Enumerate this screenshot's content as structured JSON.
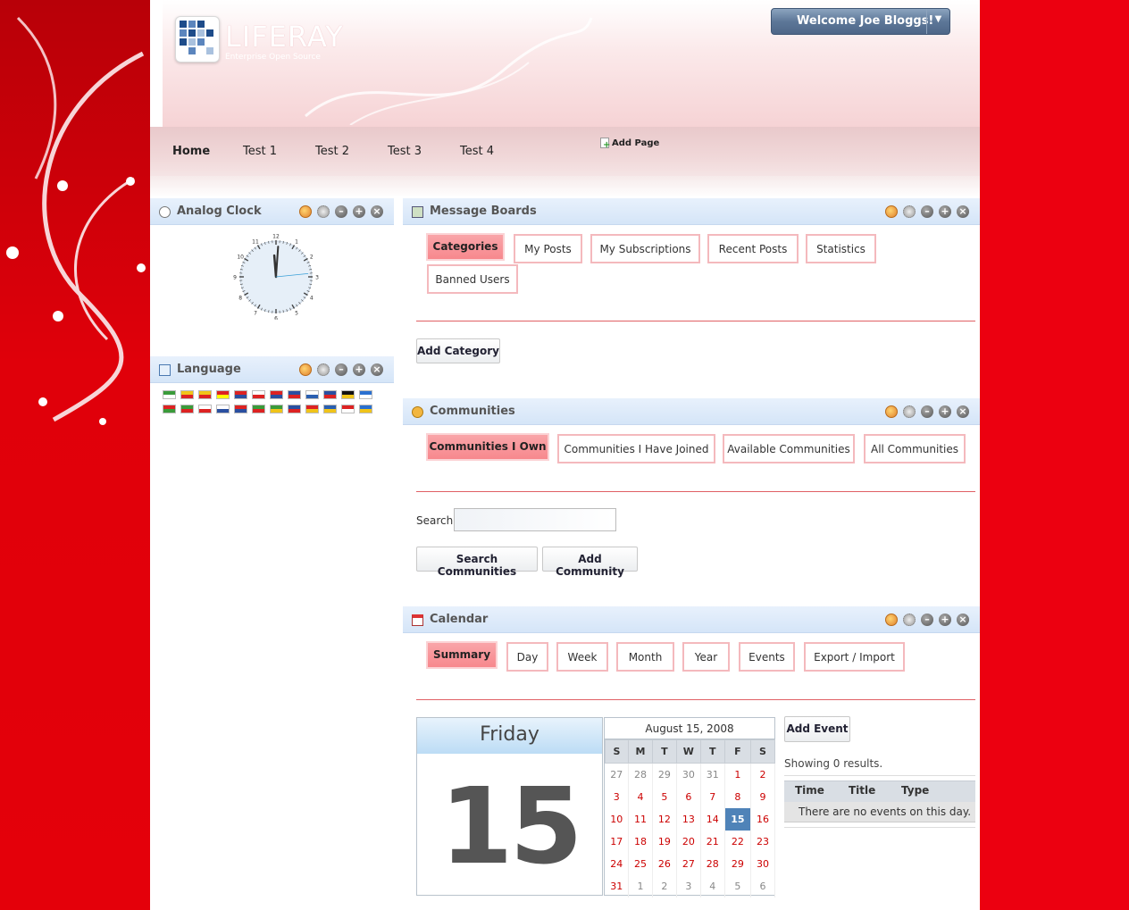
{
  "header": {
    "logo_text": "LIFERAY",
    "logo_tagline": "Enterprise Open Source",
    "welcome_label": "Welcome Joe Bloggs!"
  },
  "nav": {
    "items": [
      "Home",
      "Test 1",
      "Test 2",
      "Test 3",
      "Test 4"
    ],
    "add_page_label": "Add Page"
  },
  "clock_portlet": {
    "title": "Analog Clock",
    "numbers": [
      "12",
      "1",
      "2",
      "3",
      "4",
      "5",
      "6",
      "7",
      "8",
      "9",
      "10",
      "11"
    ]
  },
  "language_portlet": {
    "title": "Language"
  },
  "message_boards": {
    "title": "Message Boards",
    "tabs": [
      "Categories",
      "My Posts",
      "My Subscriptions",
      "Recent Posts",
      "Statistics",
      "Banned Users"
    ],
    "add_button": "Add Category"
  },
  "communities": {
    "title": "Communities",
    "tabs": [
      "Communities I Own",
      "Communities I Have Joined",
      "Available Communities",
      "All Communities"
    ],
    "search_label": "Search",
    "search_value": "",
    "search_button": "Search Communities",
    "add_button": "Add Community"
  },
  "calendar": {
    "title": "Calendar",
    "tabs": [
      "Summary",
      "Day",
      "Week",
      "Month",
      "Year",
      "Events",
      "Export / Import"
    ],
    "day_name": "Friday",
    "day_number": "15",
    "month_title": "August 15, 2008",
    "weekdays": [
      "S",
      "M",
      "T",
      "W",
      "T",
      "F",
      "S"
    ],
    "weeks": [
      [
        "27",
        "28",
        "29",
        "30",
        "31",
        "1",
        "2"
      ],
      [
        "3",
        "4",
        "5",
        "6",
        "7",
        "8",
        "9"
      ],
      [
        "10",
        "11",
        "12",
        "13",
        "14",
        "15",
        "16"
      ],
      [
        "17",
        "18",
        "19",
        "20",
        "21",
        "22",
        "23"
      ],
      [
        "24",
        "25",
        "26",
        "27",
        "28",
        "29",
        "30"
      ],
      [
        "31",
        "1",
        "2",
        "3",
        "4",
        "5",
        "6"
      ]
    ],
    "add_event_button": "Add Event",
    "results_text": "Showing 0 results.",
    "columns": [
      "Time",
      "Title",
      "Type"
    ],
    "empty_text": "There are no events on this day."
  },
  "colors": {
    "accent_red": "#e8000b",
    "tab_active": "#f7888d",
    "portlet_header": "#d5e5f8",
    "today_highlight": "#4f83b8"
  }
}
